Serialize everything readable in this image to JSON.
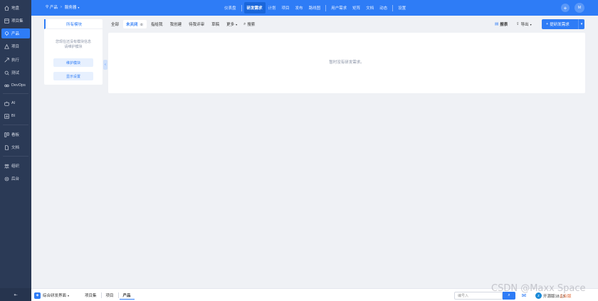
{
  "sidebar": {
    "items": [
      {
        "label": "地盘",
        "icon": "home-icon",
        "active": false
      },
      {
        "label": "项目集",
        "icon": "project-set-icon",
        "active": false
      },
      {
        "label": "产品",
        "icon": "product-icon",
        "active": true
      },
      {
        "label": "项目",
        "icon": "project-icon",
        "active": false
      },
      {
        "label": "执行",
        "icon": "execution-icon",
        "active": false
      },
      {
        "label": "测试",
        "icon": "test-icon",
        "active": false
      },
      {
        "label": "DevOps",
        "icon": "devops-icon",
        "active": false
      },
      {
        "label": "AI",
        "icon": "ai-icon",
        "active": false
      },
      {
        "label": "BI",
        "icon": "bi-icon",
        "active": false
      },
      {
        "label": "看板",
        "icon": "kanban-icon",
        "active": false
      },
      {
        "label": "文档",
        "icon": "doc-icon",
        "active": false
      },
      {
        "label": "组织",
        "icon": "org-icon",
        "active": false
      },
      {
        "label": "后台",
        "icon": "admin-icon",
        "active": false
      }
    ],
    "collapse": "⇤"
  },
  "topbar": {
    "breadcrumb_root": "产品",
    "breadcrumb_current": "服务器",
    "nav": [
      "仪表盘",
      "研发需求",
      "计划",
      "项目",
      "发布",
      "路线图",
      "用户需求",
      "矩阵",
      "文档",
      "动态",
      "设置"
    ],
    "nav_active": "研发需求",
    "avatar": "M"
  },
  "module_panel": {
    "title": "所有模块",
    "empty_line1": "您现在还没有模块信息",
    "empty_line2": "请维护模块",
    "maintain_button": "维护模块",
    "display_button": "显示设置"
  },
  "filters": {
    "tabs": [
      {
        "label": "全部",
        "active": false
      },
      {
        "label": "未关闭",
        "active": true,
        "count": "0"
      },
      {
        "label": "指给我",
        "active": false
      },
      {
        "label": "我创建",
        "active": false
      },
      {
        "label": "待我评审",
        "active": false
      },
      {
        "label": "草稿",
        "active": false
      },
      {
        "label": "更多",
        "active": false
      }
    ],
    "search": "搜索"
  },
  "actions": {
    "report": "报表",
    "export": "导出",
    "create": "提研发需求"
  },
  "content": {
    "empty": "暂时没有研发需求。"
  },
  "bottombar": {
    "workspace": "综合研发界面",
    "tabs": [
      "项目集",
      "项目",
      "产品"
    ],
    "active_tab": "产品",
    "search_placeholder": "编号入",
    "version": "开源版18.13",
    "edition": "企业版"
  },
  "watermark": "CSDN @Maxx Space",
  "colors": {
    "primary": "#2e7cf6",
    "sidebar_bg": "#2b3a56",
    "page_bg": "#eff1f5"
  }
}
